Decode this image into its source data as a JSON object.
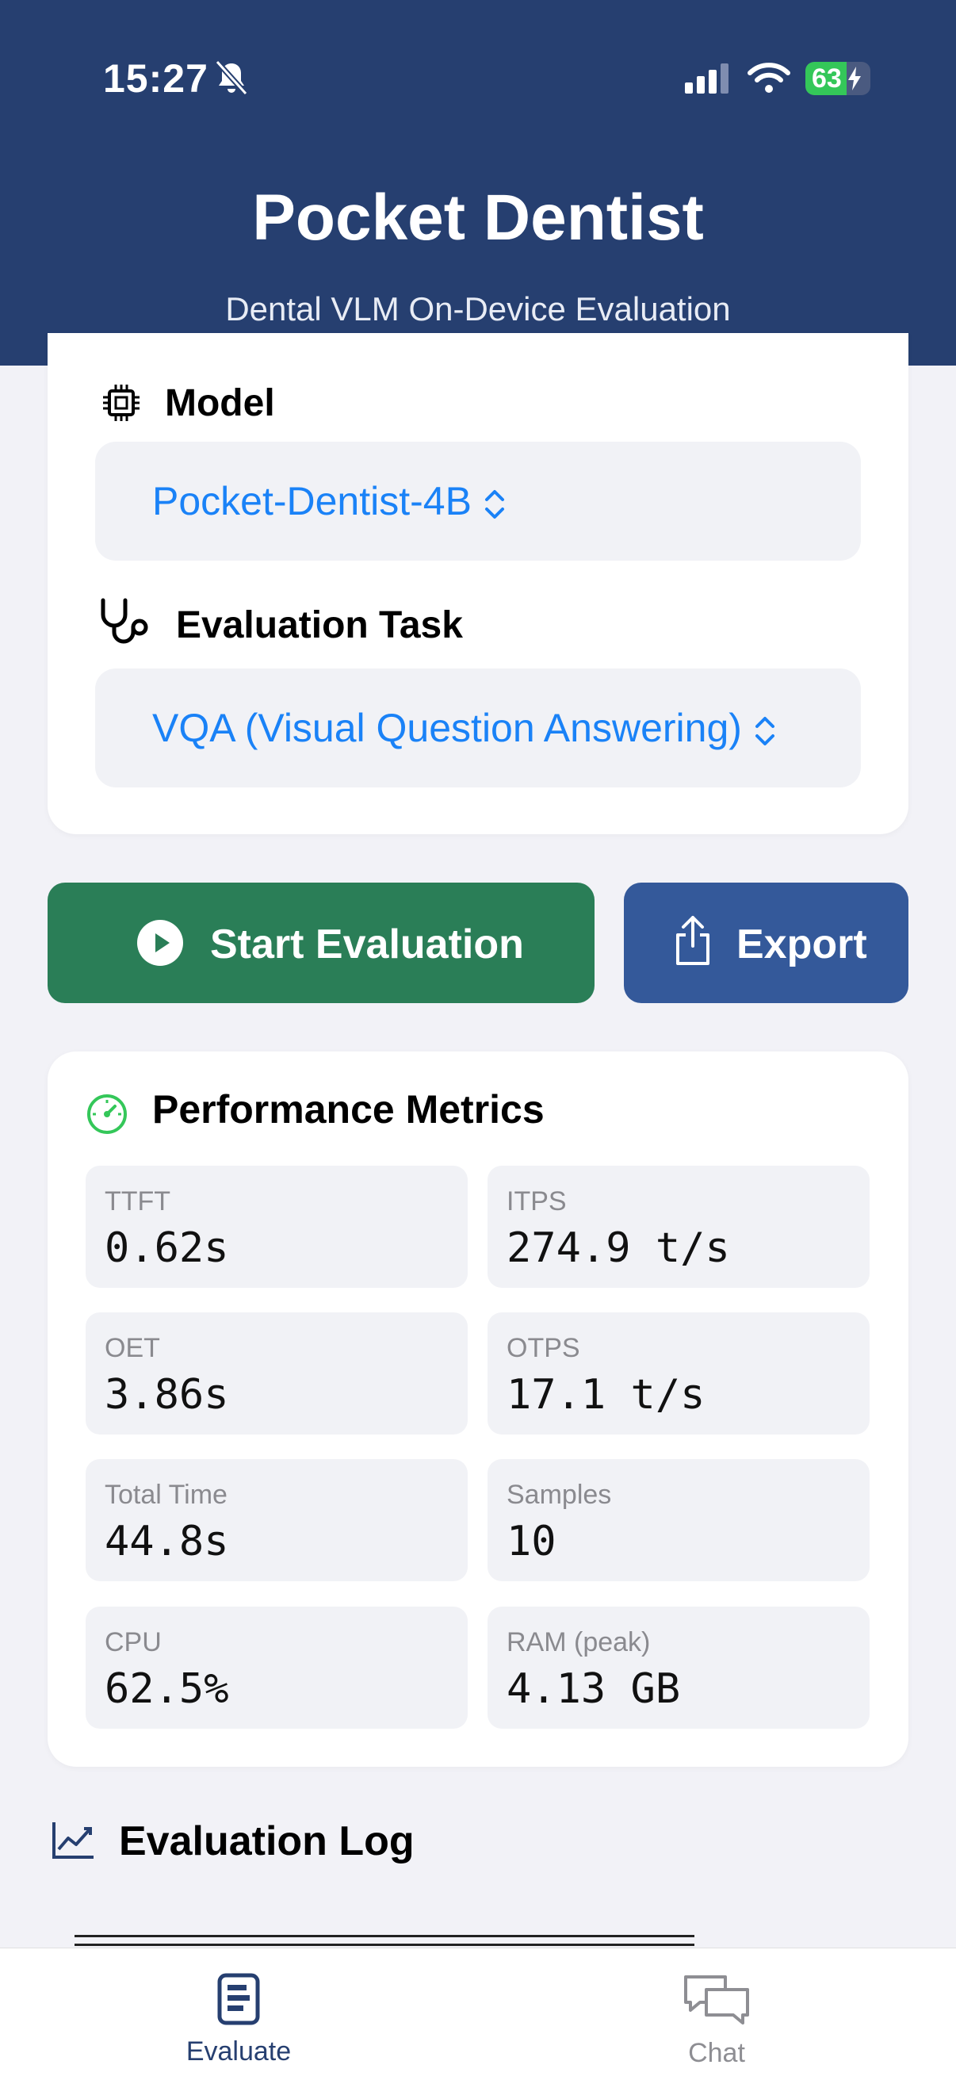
{
  "status_bar": {
    "time": "15:27",
    "battery": "63"
  },
  "header": {
    "title": "Pocket Dentist",
    "subtitle": "Dental VLM On-Device Evaluation"
  },
  "config": {
    "model_label": "Model",
    "model_value": "Pocket-Dentist-4B",
    "task_label": "Evaluation Task",
    "task_value": "VQA (Visual Question Answering)"
  },
  "actions": {
    "start_label": "Start Evaluation",
    "export_label": "Export"
  },
  "metrics": {
    "title": "Performance Metrics",
    "items": [
      {
        "label": "TTFT",
        "value": "0.62s"
      },
      {
        "label": "ITPS",
        "value": "274.9 t/s"
      },
      {
        "label": "OET",
        "value": "3.86s"
      },
      {
        "label": "OTPS",
        "value": "17.1 t/s"
      },
      {
        "label": "Total Time",
        "value": "44.8s"
      },
      {
        "label": "Samples",
        "value": "10"
      },
      {
        "label": "CPU",
        "value": "62.5%"
      },
      {
        "label": "RAM (peak)",
        "value": "4.13 GB"
      }
    ]
  },
  "log": {
    "title": "Evaluation Log"
  },
  "tabs": [
    {
      "label": "Evaluate",
      "active": true
    },
    {
      "label": "Chat",
      "active": false
    }
  ],
  "colors": {
    "header": "#263f70",
    "start": "#2a7e57",
    "export": "#34599a",
    "accent": "#1a82f7",
    "active_tab": "#263f70",
    "inactive_tab": "#8e8e93",
    "gauge": "#34c759"
  }
}
